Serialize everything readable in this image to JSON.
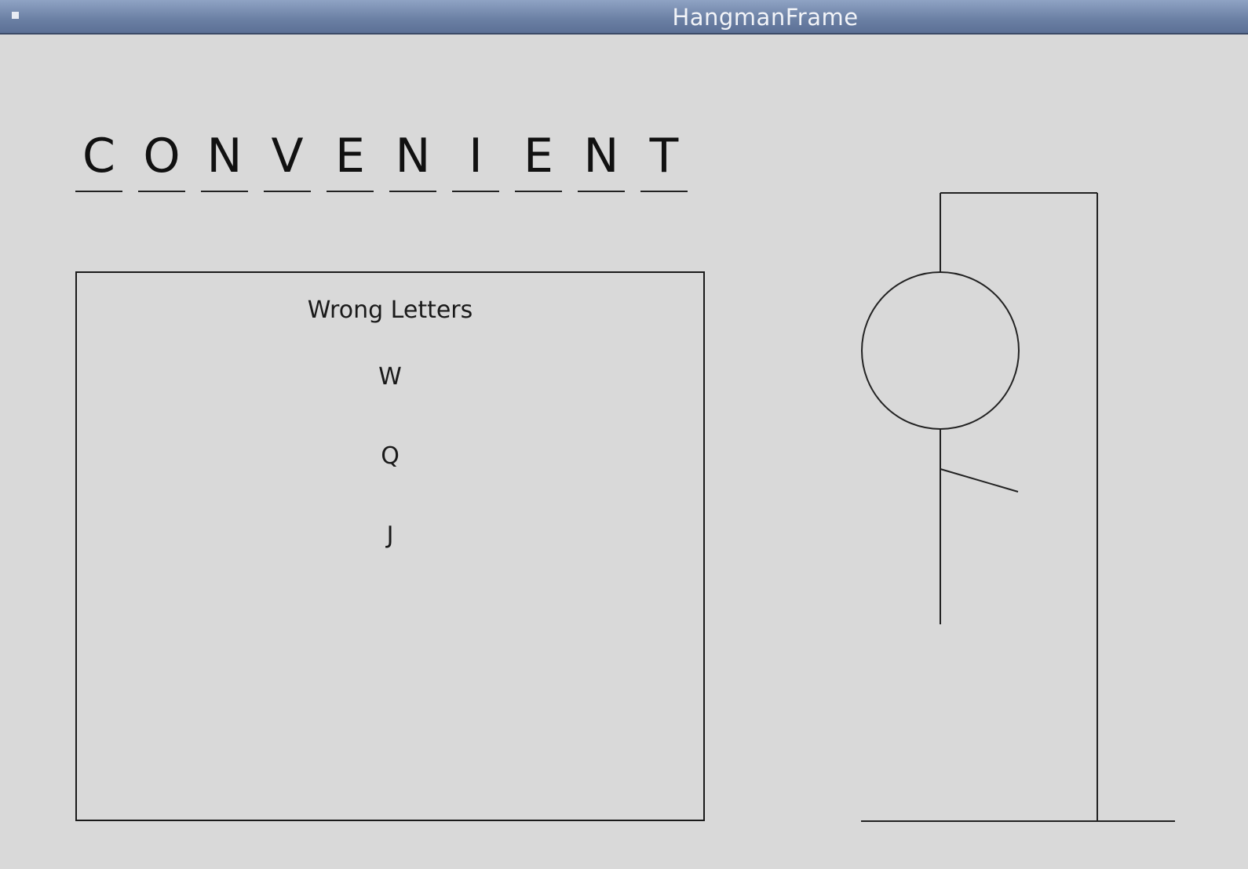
{
  "window": {
    "title": "HangmanFrame"
  },
  "word": {
    "letters": [
      "C",
      "O",
      "N",
      "V",
      "E",
      "N",
      "I",
      "E",
      "N",
      "T"
    ]
  },
  "wrong_letters": {
    "title": "Wrong Letters",
    "letters": [
      "W",
      "Q",
      "J"
    ]
  },
  "hangman": {
    "parts_drawn": [
      "head",
      "body",
      "right-arm"
    ]
  }
}
